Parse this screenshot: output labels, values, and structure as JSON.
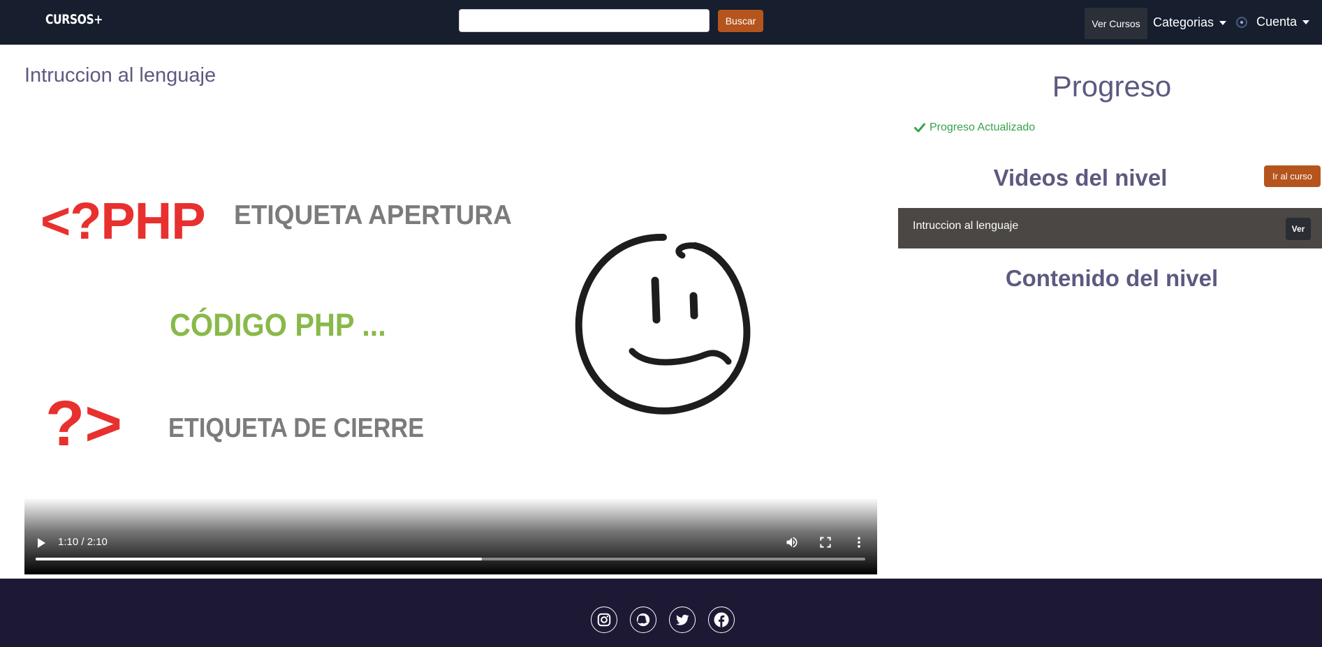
{
  "navbar": {
    "brand": "CURSOS+",
    "search": {
      "placeholder": "",
      "value": ""
    },
    "search_button": "Buscar",
    "view_courses": "Ver Cursos",
    "categories": "Categorias",
    "account": "Cuenta"
  },
  "main": {
    "title": "Intruccion al lenguaje",
    "video": {
      "frame_text": {
        "php_open": "<?PHP",
        "label_open": "ETIQUETA APERTURA",
        "code": "CÓDIGO PHP ...",
        "php_close": "?>",
        "label_close": "ETIQUETA DE CIERRE"
      },
      "time": "1:10 / 2:10",
      "progress": 0.538
    }
  },
  "sidebar": {
    "progress_title": "Progreso",
    "status": "Progreso Actualizado",
    "videos_title": "Videos del nivel",
    "goto_course_button": "Ir al curso",
    "videos": [
      {
        "label": "Intruccion al lenguaje",
        "button": "Ver"
      }
    ],
    "content_title": "Contenido del nivel"
  },
  "footer": {
    "social_icons": [
      "instagram-icon",
      "snapchat-icon",
      "twitter-icon",
      "facebook-icon"
    ]
  },
  "colors": {
    "navbar_bg": "#171e2e",
    "accent": "#b5551d",
    "heading": "#5c5a80",
    "success": "#3aa14a",
    "footer_bg": "#1d1934"
  }
}
